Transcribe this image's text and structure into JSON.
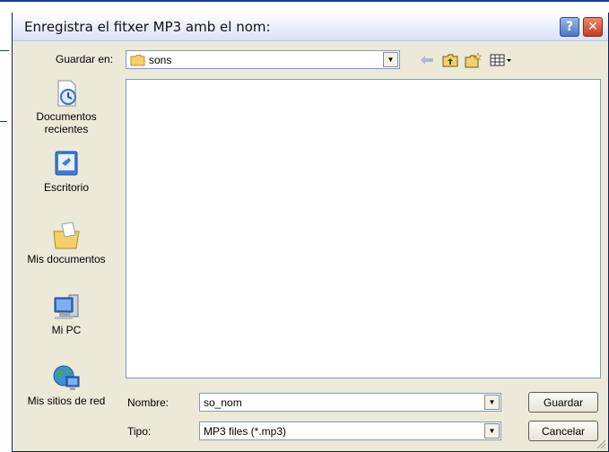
{
  "dialog": {
    "title": "Enregistra el fitxer MP3 amb el nom:",
    "help_icon": "help-icon",
    "close_icon": "close-icon",
    "help_glyph": "?",
    "close_glyph": "✕"
  },
  "save_in": {
    "label": "Guardar en:",
    "value": "sons",
    "folder_icon": "folder-icon"
  },
  "toolbar": {
    "back_icon": "back-arrow-icon",
    "up_icon": "up-folder-icon",
    "new_folder_icon": "new-folder-icon",
    "views_icon": "views-menu-icon"
  },
  "places": [
    {
      "label": "Documentos recientes",
      "icon": "recent-documents-icon"
    },
    {
      "label": "Escritorio",
      "icon": "desktop-icon"
    },
    {
      "label": "Mis documentos",
      "icon": "my-documents-icon"
    },
    {
      "label": "Mi PC",
      "icon": "my-computer-icon"
    },
    {
      "label": "Mis sitios de red",
      "icon": "network-places-icon"
    }
  ],
  "form": {
    "name_label": "Nombre:",
    "name_value": "so_nom",
    "type_label": "Tipo:",
    "type_value": "MP3 files (*.mp3)",
    "save_button": "Guardar",
    "cancel_button": "Cancelar"
  },
  "colors": {
    "dialog_bg": "#ece9d8",
    "title_gradient_top": "#ffffff",
    "close_red": "#c33b1f",
    "help_blue": "#4e77c7",
    "field_border": "#7f9db9"
  }
}
